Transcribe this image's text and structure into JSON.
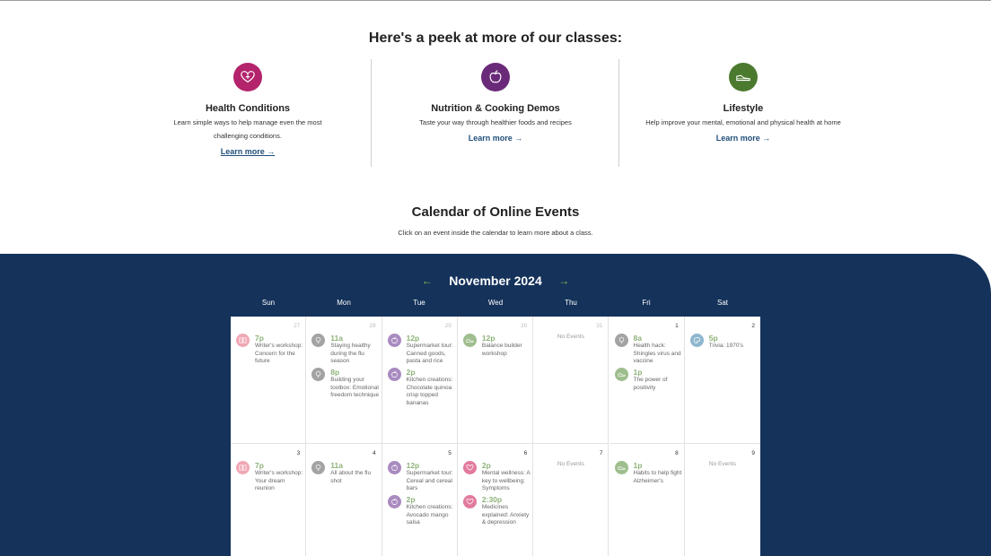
{
  "peek": {
    "title": "Here's a peek at more of our classes:",
    "cards": [
      {
        "title": "Health Conditions",
        "desc": "Learn simple ways to help manage even the most challenging conditions.",
        "link": "Learn more →",
        "color": "#b3246c",
        "icon": "heart-icon"
      },
      {
        "title": "Nutrition & Cooking Demos",
        "desc": "Taste your way through healthier foods and recipes",
        "link": "Learn more →",
        "color": "#6a2a79",
        "icon": "apple-icon"
      },
      {
        "title": "Lifestyle",
        "desc": "Help improve your mental, emotional and physical health at home",
        "link": "Learn more →",
        "color": "#4b7a2f",
        "icon": "sneaker-icon"
      }
    ]
  },
  "calendar": {
    "title": "Calendar of Online Events",
    "subtitle": "Click on an event inside the calendar to learn more about a class.",
    "month": "November 2024",
    "prev_arrow": "←",
    "next_arrow": "→",
    "weekdays": [
      "Sun",
      "Mon",
      "Tue",
      "Wed",
      "Thu",
      "Fri",
      "Sat"
    ],
    "no_events_label": "No Events",
    "colors": {
      "band": "#14325a",
      "accent": "#8dc63f",
      "time": "#8fb27a"
    },
    "weeks": [
      [
        {
          "day": "27",
          "muted": true,
          "events": [
            {
              "time": "7p",
              "title": "Writer's workshop: Concern for the future",
              "icon": "book-icon",
              "color": "#f0a7b4"
            }
          ]
        },
        {
          "day": "28",
          "muted": true,
          "events": [
            {
              "time": "11a",
              "title": "Staying healthy during the flu season",
              "icon": "lightbulb-icon",
              "color": "#a3a3a3"
            },
            {
              "time": "8p",
              "title": "Building your toolbox: Emotional freedom technique",
              "icon": "lightbulb-icon",
              "color": "#a3a3a3"
            }
          ]
        },
        {
          "day": "29",
          "muted": true,
          "events": [
            {
              "time": "12p",
              "title": "Supermarket tour: Canned goods, pasta and rice",
              "icon": "apple-icon",
              "color": "#a98bc0"
            },
            {
              "time": "2p",
              "title": "Kitchen creations: Chocolate quinoa crisp topped bananas",
              "icon": "apple-icon",
              "color": "#a98bc0"
            }
          ]
        },
        {
          "day": "30",
          "muted": true,
          "events": [
            {
              "time": "12p",
              "title": "Balance builder workshop",
              "icon": "sneaker-icon",
              "color": "#9fbe8e"
            }
          ]
        },
        {
          "day": "31",
          "muted": true,
          "events": []
        },
        {
          "day": "1",
          "muted": false,
          "events": [
            {
              "time": "8a",
              "title": "Health hack: Shingles virus and vaccine",
              "icon": "lightbulb-icon",
              "color": "#a3a3a3"
            },
            {
              "time": "1p",
              "title": "The power of positivity",
              "icon": "sneaker-icon",
              "color": "#9fbe8e"
            }
          ]
        },
        {
          "day": "2",
          "muted": false,
          "events": [
            {
              "time": "5p",
              "title": "Trivia: 1970's",
              "icon": "palette-icon",
              "color": "#8eb7cf"
            }
          ]
        }
      ],
      [
        {
          "day": "3",
          "muted": false,
          "events": [
            {
              "time": "7p",
              "title": "Writer's workshop: Your dream reunion",
              "icon": "book-icon",
              "color": "#f0a7b4"
            }
          ]
        },
        {
          "day": "4",
          "muted": false,
          "events": [
            {
              "time": "11a",
              "title": "All about the flu shot",
              "icon": "lightbulb-icon",
              "color": "#a3a3a3"
            }
          ]
        },
        {
          "day": "5",
          "muted": false,
          "events": [
            {
              "time": "12p",
              "title": "Supermarket tour: Cereal and cereal bars",
              "icon": "apple-icon",
              "color": "#a98bc0"
            },
            {
              "time": "2p",
              "title": "Kitchen creations: Avocado mango salsa",
              "icon": "apple-icon",
              "color": "#a98bc0"
            }
          ]
        },
        {
          "day": "6",
          "muted": false,
          "events": [
            {
              "time": "2p",
              "title": "Mental wellness: A key to wellbeing: Symptoms",
              "icon": "heart-icon",
              "color": "#e27a9e"
            },
            {
              "time": "2:30p",
              "title": "Medicines explained: Anxiety & depression",
              "icon": "heart-icon",
              "color": "#e27a9e"
            }
          ]
        },
        {
          "day": "7",
          "muted": false,
          "events": []
        },
        {
          "day": "8",
          "muted": false,
          "events": [
            {
              "time": "1p",
              "title": "Habits to help fight Alzheimer's",
              "icon": "sneaker-icon",
              "color": "#9fbe8e"
            }
          ]
        },
        {
          "day": "9",
          "muted": false,
          "events": []
        }
      ]
    ]
  }
}
